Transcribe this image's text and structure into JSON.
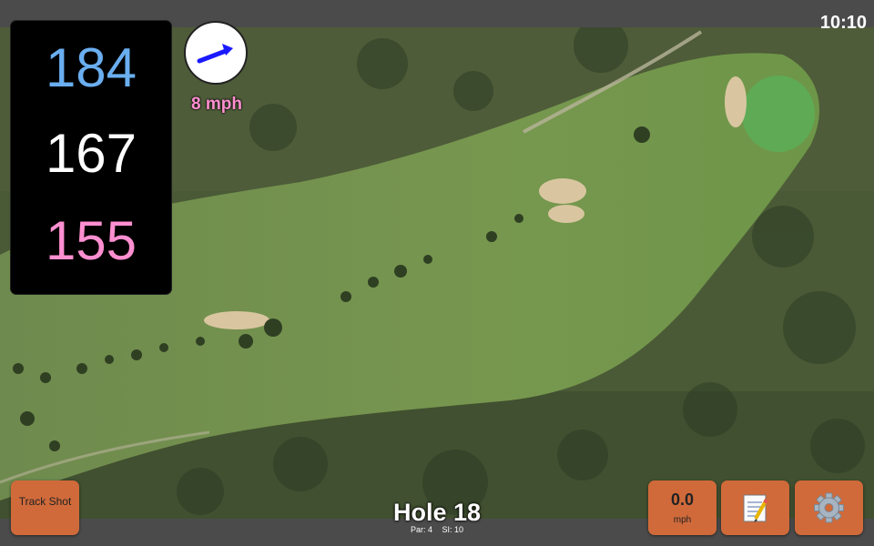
{
  "status_bar": {
    "time": "10:10"
  },
  "distances": {
    "back": "184",
    "middle": "167",
    "front": "155"
  },
  "wind": {
    "speed_label": "8 mph"
  },
  "hole": {
    "title": "Hole 18",
    "par_label": "Par: 4",
    "si_label": "SI: 10"
  },
  "buttons": {
    "track_shot_label": "Track Shot",
    "speed_value": "0.0",
    "speed_unit": "mph",
    "notes_icon": "notepad-icon",
    "settings_icon": "gear-icon"
  },
  "colors": {
    "back_distance": "#6aaef0",
    "middle_distance": "#ffffff",
    "front_distance": "#ff8fd0",
    "button": "#d06a3a",
    "wind_arrow": "#1a1aff"
  }
}
